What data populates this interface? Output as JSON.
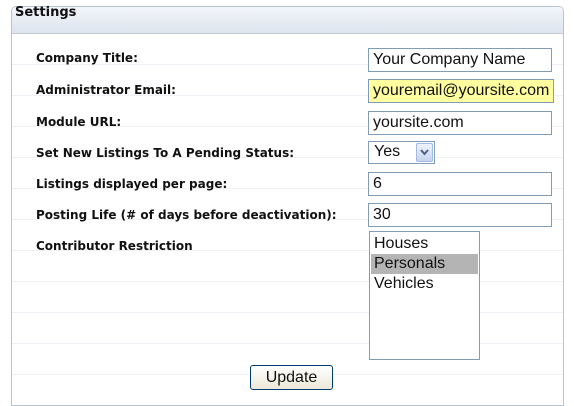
{
  "panel": {
    "title": "Settings"
  },
  "fields": {
    "company_title": {
      "label": "Company Title:",
      "value": "Your Company Name"
    },
    "admin_email": {
      "label": "Administrator Email:",
      "value": "youremail@yoursite.com"
    },
    "module_url": {
      "label": "Module URL:",
      "value": "yoursite.com"
    },
    "pending_status": {
      "label": "Set New Listings To A Pending Status:",
      "value": "Yes"
    },
    "listings_per_page": {
      "label": "Listings displayed per page:",
      "value": "6"
    },
    "posting_life": {
      "label": "Posting Life (# of days before deactivation):",
      "value": "30"
    },
    "contributor_restriction": {
      "label": "Contributor Restriction",
      "options": [
        "Houses",
        "Personals",
        "Vehicles"
      ],
      "selected": "Personals"
    }
  },
  "buttons": {
    "update_label": "Update"
  },
  "colors": {
    "highlight_field": "#ffffa0",
    "selected_option": "#b4b4b4",
    "header_bar": "#dde4ee"
  }
}
